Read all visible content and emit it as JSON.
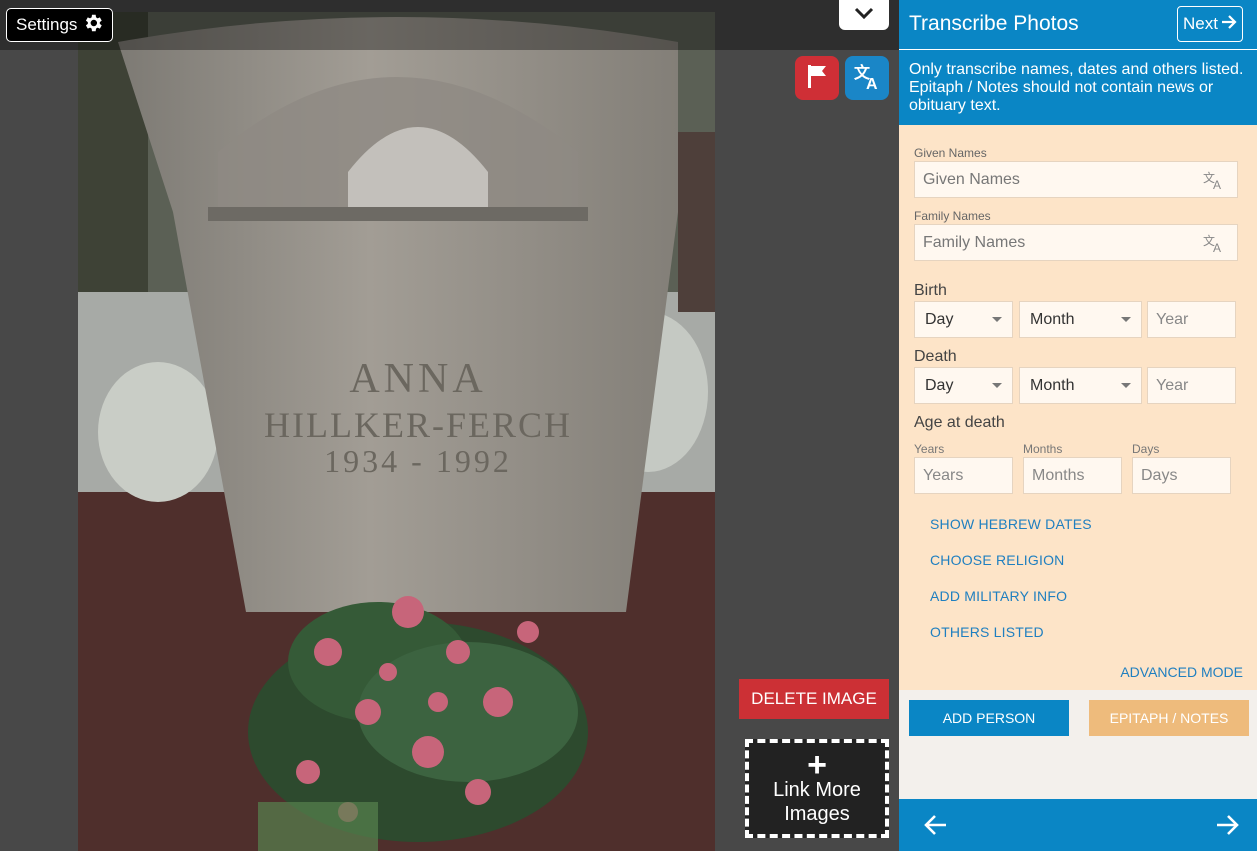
{
  "viewer": {
    "settings_label": "Settings",
    "delete_label": "DELETE IMAGE",
    "link_more_plus": "+",
    "link_more_label": "Link More Images",
    "photo_text": {
      "name": "ANNA",
      "surname": "HILLKER-FERCH",
      "years": "1934 - 1992"
    }
  },
  "panel": {
    "title": "Transcribe Photos",
    "next_label": "Next",
    "notice": "Only transcribe names, dates and others listed. Epitaph / Notes should not contain news or obituary text.",
    "given_names": {
      "label": "Given Names",
      "placeholder": "Given Names"
    },
    "family_names": {
      "label": "Family Names",
      "placeholder": "Family Names"
    },
    "birth": {
      "label": "Birth",
      "day": "Day",
      "month": "Month",
      "year": "Year"
    },
    "death": {
      "label": "Death",
      "day": "Day",
      "month": "Month",
      "year": "Year"
    },
    "age": {
      "label": "Age at death",
      "years_label": "Years",
      "years_placeholder": "Years",
      "months_label": "Months",
      "months_placeholder": "Months",
      "days_label": "Days",
      "days_placeholder": "Days"
    },
    "links": {
      "hebrew": "SHOW HEBREW DATES",
      "religion": "CHOOSE RELIGION",
      "military": "ADD MILITARY INFO",
      "others": "OTHERS LISTED",
      "advanced": "ADVANCED MODE"
    },
    "add_person": "ADD PERSON",
    "epitaph": "EPITAPH / NOTES"
  },
  "colors": {
    "accent": "#0a86c5",
    "form_bg": "#fde4c8",
    "delete": "#cc3035",
    "epitaph_btn": "#eebb7c"
  },
  "icons": [
    "gear-icon",
    "chevron-down-icon",
    "flag-icon",
    "translate-icon",
    "arrow-right-icon",
    "arrow-left-icon"
  ]
}
